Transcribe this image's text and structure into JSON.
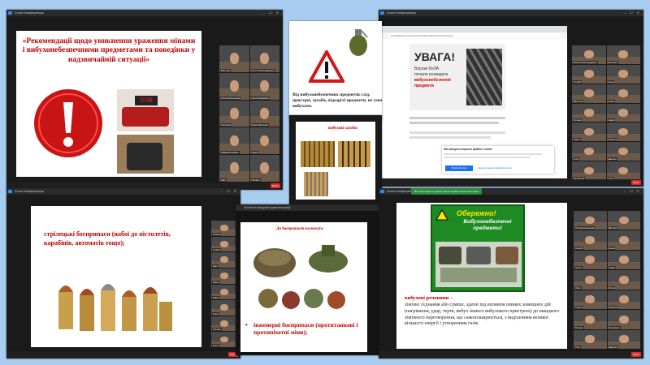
{
  "app_title": "Zoom Конференція",
  "share_banner": "Ви переглядаєте демонстрацію екрана Олени Кольцової",
  "share_owner": "Олени Кольцової демонстрації",
  "view_options": "Параметри перегляду",
  "end_label": "Вийти",
  "win1": {
    "title": "«Рекомендації щодо уникнення ураження мінами і вибухонебезпечними предметами та поведінки у надзвичайній ситуації»",
    "timer": "0:08"
  },
  "win2": {
    "text": "Від вибухонебезпечних предметів слід, пристрої, засоби, підозрілі предмети, не умов вибухати."
  },
  "win3": {
    "search_placeholder": "kyivoblwater.gov.ua/news/vybukhonebezpechni-predmety",
    "poster_title": "УВАГА!",
    "poster_sub1": "Ворожі БпЛА",
    "poster_sub2": "почали розкидати",
    "poster_sub3": "вибухонебезпечні",
    "poster_sub4": "предмети",
    "popup_title": "Ми використовуємо файли Cookie",
    "popup_btn1": "Прийняти все",
    "popup_btn2": "Налаштування файлів Cookie"
  },
  "win4": {
    "heading": "вибухові засоби:"
  },
  "win5": {
    "text": "стрілецькі боєприпаси (набої до пістолетів, карабінів, автоматів тощо);"
  },
  "win6": {
    "title": "До боєприпасів належать:",
    "bullet": "інженерні боєприпаси (протитанкові і протипіхотні міни);"
  },
  "win7": {
    "poster_title": "Обережно!",
    "poster_sub": "Вибухонебезпечні предмети!",
    "term": "вибухові речовини –",
    "definition": "хімічні з'єднання або суміші, здатні під впливом певних зовнішніх дій (нагрівання, удар, тертя, вибух іншого вибухового пристрою) до швидкого хімічного перетворення, що самопоширюється, з виділенням великої кількості енергії і утворенням газів."
  },
  "participants": {
    "a": [
      "Вікторія",
      "Юля Олександрівна",
      "Олена Кольцова",
      "Анна Андрієнко",
      "Світлана",
      "Ірина Мельник",
      "Адріана Коваль",
      "Надія",
      "Іван",
      "Оксана"
    ],
    "b": [
      "Юлія Олександрівна",
      "Валерія",
      "Сергій",
      "Анна",
      "Вікторія",
      "Ірина",
      "Олена",
      "Надія",
      "Тарас",
      "Марина",
      "Ілля",
      "Данило",
      "Катерина",
      "Олег"
    ],
    "c": [
      "Олена",
      "Сергій",
      "Іван",
      "Ірина",
      "Марія",
      "Анна",
      "Тетяна",
      "Олег"
    ],
    "d": [
      "Олена Кольцова",
      "Вікторія",
      "Сергій",
      "Анна",
      "Ірина",
      "Надія",
      "Олег",
      "Юлія",
      "Тарас",
      "Марина",
      "Богдан",
      "Катерина",
      "Ілля",
      "Данило"
    ]
  },
  "colors": {
    "accent": "#c00000",
    "share_green": "#2d8a3e",
    "end_red": "#e02828"
  }
}
